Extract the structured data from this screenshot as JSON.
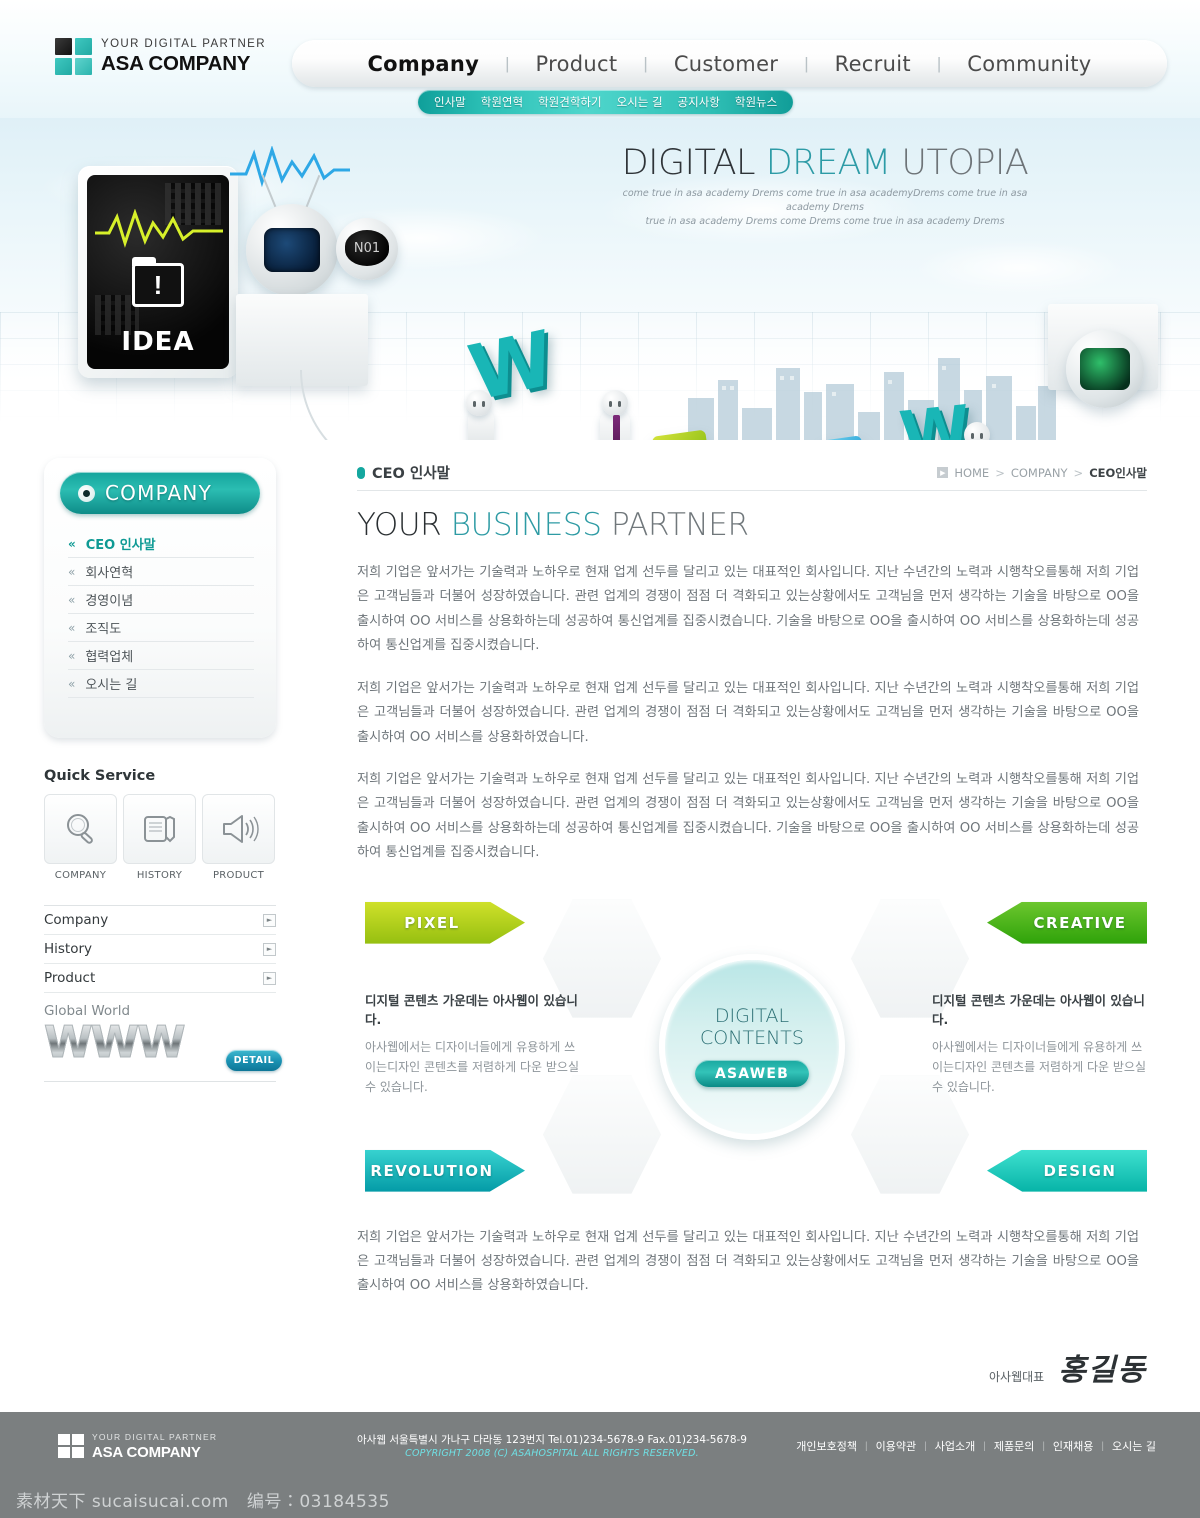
{
  "header": {
    "logo": {
      "tagline": "YOUR DIGITAL PARTNER",
      "name": "ASA COMPANY"
    },
    "main_nav": [
      {
        "label": "Company",
        "active": true
      },
      {
        "label": "Product",
        "active": false
      },
      {
        "label": "Customer",
        "active": false
      },
      {
        "label": "Recruit",
        "active": false
      },
      {
        "label": "Community",
        "active": false
      }
    ],
    "sub_nav": [
      "인사말",
      "학원연혁",
      "학원견학하기",
      "오시는 길",
      "공지사항",
      "학원뉴스"
    ]
  },
  "hero": {
    "title_part1": "DIGITAL ",
    "title_part2": "DREAM ",
    "title_part3": "UTOPIA",
    "subtitle_line1": "come true in asa academy Drems come true in asa academyDrems come true in asa academy Drems",
    "subtitle_line2": "true in asa academy Drems come Drems come true in asa academy Drems",
    "idea_label": "IDEA",
    "n01_label": "N01",
    "letter_w": "W",
    "cube_question": "?"
  },
  "sidebar": {
    "panel_title": "COMPANY",
    "items": [
      {
        "label": "CEO 인사말",
        "active": true
      },
      {
        "label": "회사연혁",
        "active": false
      },
      {
        "label": "경영이념",
        "active": false
      },
      {
        "label": "조직도",
        "active": false
      },
      {
        "label": "협력업체",
        "active": false
      },
      {
        "label": "오시는 길",
        "active": false
      }
    ],
    "quick_service": {
      "title": "Quick Service",
      "items": [
        {
          "label": "COMPANY",
          "icon": "magnifier-icon"
        },
        {
          "label": "HISTORY",
          "icon": "notebook-pen-icon"
        },
        {
          "label": "PRODUCT",
          "icon": "megaphone-icon"
        }
      ]
    },
    "mini_list": [
      "Company",
      "History",
      "Product"
    ],
    "global_world": {
      "title": "Global World",
      "www": "WWW",
      "detail_label": "DETAIL"
    }
  },
  "content": {
    "section_title": "CEO 인사말",
    "breadcrumb": {
      "home": "HOME",
      "level2": "COMPANY",
      "current": "CEO인사말",
      "separator": ">"
    },
    "headline_part1": "YOUR ",
    "headline_part2": "BUSINESS ",
    "headline_part3": "PARTNER",
    "paragraph1": "저희 기업은 앞서가는 기술력과 노하우로 현재 업계 선두를 달리고 있는 대표적인 회사입니다. 지난 수년간의 노력과 시행착오를통해 저희 기업은 고객님들과 더불어 성장하였습니다. 관련 업계의 경쟁이 점점 더 격화되고 있는상황에서도 고객님을 먼저 생각하는 기술을 바탕으로 OO을 출시하여 OO 서비스를 상용화하는데 성공하여 통신업계를 집중시켰습니다. 기술을 바탕으로 OO을 출시하여 OO 서비스를 상용화하는데 성공하여 통신업계를 집중시켰습니다.",
    "paragraph2": "저희 기업은 앞서가는 기술력과 노하우로 현재 업계 선두를 달리고 있는 대표적인 회사입니다. 지난 수년간의 노력과 시행착오를통해 저희 기업은 고객님들과 더불어 성장하였습니다. 관련 업계의 경쟁이 점점 더 격화되고 있는상황에서도 고객님을 먼저 생각하는 기술을 바탕으로 OO을 출시하여 OO 서비스를 상용화하였습니다.",
    "paragraph3": "저희 기업은 앞서가는 기술력과 노하우로 현재 업계 선두를 달리고 있는 대표적인 회사입니다. 지난 수년간의 노력과 시행착오를통해 저희 기업은 고객님들과 더불어 성장하였습니다. 관련 업계의 경쟁이 점점 더 격화되고 있는상황에서도 고객님을 먼저 생각하는 기술을 바탕으로 OO을 출시하여 OO 서비스를 상용화하는데 성공하여 통신업계를 집중시켰습니다. 기술을 바탕으로 OO을 출시하여 OO 서비스를 상용화하는데 성공하여 통신업계를 집중시켰습니다.",
    "paragraph_bottom": "저희 기업은 앞서가는 기술력과 노하우로 현재 업계 선두를 달리고 있는 대표적인 회사입니다. 지난 수년간의 노력과 시행착오를통해 저희 기업은 고객님들과 더불어 성장하였습니다. 관련 업계의 경쟁이 점점 더 격화되고 있는상황에서도 고객님을 먼저 생각하는 기술을 바탕으로 OO을 출시하여 OO 서비스를 상용화하였습니다.",
    "signature": {
      "role": "아사웹대표",
      "name": "홍길동"
    }
  },
  "diagram": {
    "flags": {
      "pixel": "PIXEL",
      "creative": "CREATIVE",
      "revolution": "REVOLUTION",
      "design": "DESIGN"
    },
    "center": {
      "line1": "DIGITAL",
      "line2": "CONTENTS",
      "button": "ASAWEB"
    },
    "left_text": {
      "heading": "디지털 콘텐츠 가운데는 아사웹이 있습니다.",
      "body": "아사웹에서는 디자이너들에게 유용하게 쓰이는디자인 콘텐츠를 저렴하게 다운 받으실 수 있습니다."
    },
    "right_text": {
      "heading": "디지털 콘텐츠 가운데는 아사웹이 있습니다.",
      "body": "아사웹에서는 디자이너들에게 유용하게 쓰이는디자인 콘텐츠를 저렴하게 다운 받으실 수 있습니다."
    }
  },
  "footer": {
    "logo": {
      "tagline": "YOUR DIGITAL PARTNER",
      "name": "ASA COMPANY"
    },
    "address": "아사웹 서울특별시 가나구 다라동 123번지 Tel.01)234-5678-9 Fax.01)234-5678-9",
    "copyright": "COPYRIGHT 2008 (C) ASAHOSPITAL ALL RIGHTS RESERVED.",
    "links": [
      "개인보호정책",
      "이용약관",
      "사업소개",
      "제품문의",
      "인재채용",
      "오시는 길"
    ]
  },
  "watermark": {
    "site": "素材天下 sucaisucai.com",
    "id_label": "编号：03184535"
  },
  "colors": {
    "teal": "#14a79f",
    "teal_light": "#2bbdb2",
    "lime": "#95bf10",
    "green": "#2ea209",
    "cyan": "#06b3a7",
    "footer_gray": "#7b7f80"
  }
}
